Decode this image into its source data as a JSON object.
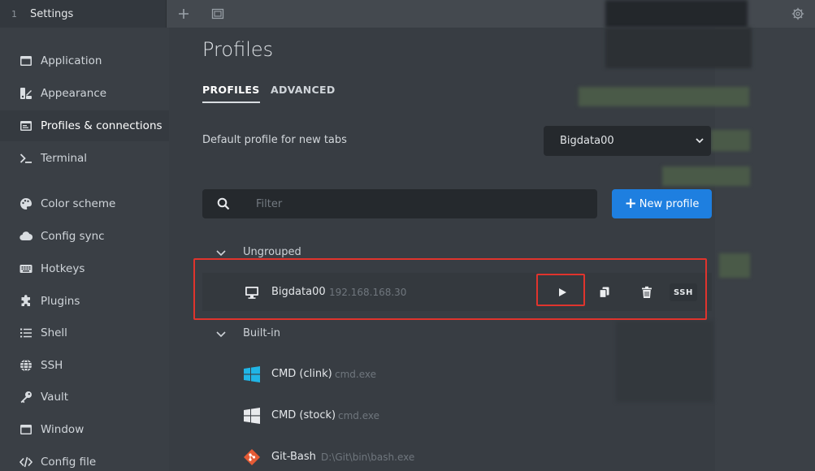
{
  "topbar": {
    "tab_number": "1",
    "tab_title": "Settings",
    "new_tab_icon": "plus-icon",
    "window_icon": "window-icon",
    "settings_icon": "gear-icon"
  },
  "sidebar": {
    "items": [
      {
        "label": "Application",
        "icon": "window-icon"
      },
      {
        "label": "Appearance",
        "icon": "palette-brush-icon"
      },
      {
        "label": "Profiles & connections",
        "icon": "window-list-icon"
      },
      {
        "label": "Terminal",
        "icon": "terminal-icon"
      },
      {
        "label": "Color scheme",
        "icon": "palette-icon"
      },
      {
        "label": "Config sync",
        "icon": "cloud-icon"
      },
      {
        "label": "Hotkeys",
        "icon": "keyboard-icon"
      },
      {
        "label": "Plugins",
        "icon": "puzzle-icon"
      },
      {
        "label": "Shell",
        "icon": "list-icon"
      },
      {
        "label": "SSH",
        "icon": "globe-icon"
      },
      {
        "label": "Vault",
        "icon": "key-icon"
      },
      {
        "label": "Window",
        "icon": "window-icon"
      },
      {
        "label": "Config file",
        "icon": "code-icon"
      }
    ],
    "active_index": 2
  },
  "main": {
    "title": "Profiles",
    "tabs": [
      {
        "label": "PROFILES",
        "active": true
      },
      {
        "label": "ADVANCED",
        "active": false
      }
    ],
    "default_profile": {
      "label": "Default profile for new tabs",
      "value": "Bigdata00"
    },
    "filter": {
      "placeholder": "Filter"
    },
    "new_profile_label": "New profile",
    "groups": [
      {
        "name": "Ungrouped",
        "profiles": [
          {
            "name": "Bigdata00",
            "detail": "192.168.168.30",
            "icon": "monitor-icon",
            "badge": "SSH"
          }
        ]
      },
      {
        "name": "Built-in",
        "profiles": [
          {
            "name": "CMD (clink)",
            "detail": "cmd.exe",
            "icon": "windows-logo-icon"
          },
          {
            "name": "CMD (stock)",
            "detail": "cmd.exe",
            "icon": "windows-logo-icon"
          },
          {
            "name": "Git-Bash",
            "detail": "D:\\Git\\bin\\bash.exe",
            "icon": "git-icon"
          }
        ]
      }
    ]
  },
  "colors": {
    "accent": "#1e7fe0",
    "highlight": "#e0342d",
    "windows_cyan": "#20b5e6",
    "git_orange": "#e55b35"
  }
}
